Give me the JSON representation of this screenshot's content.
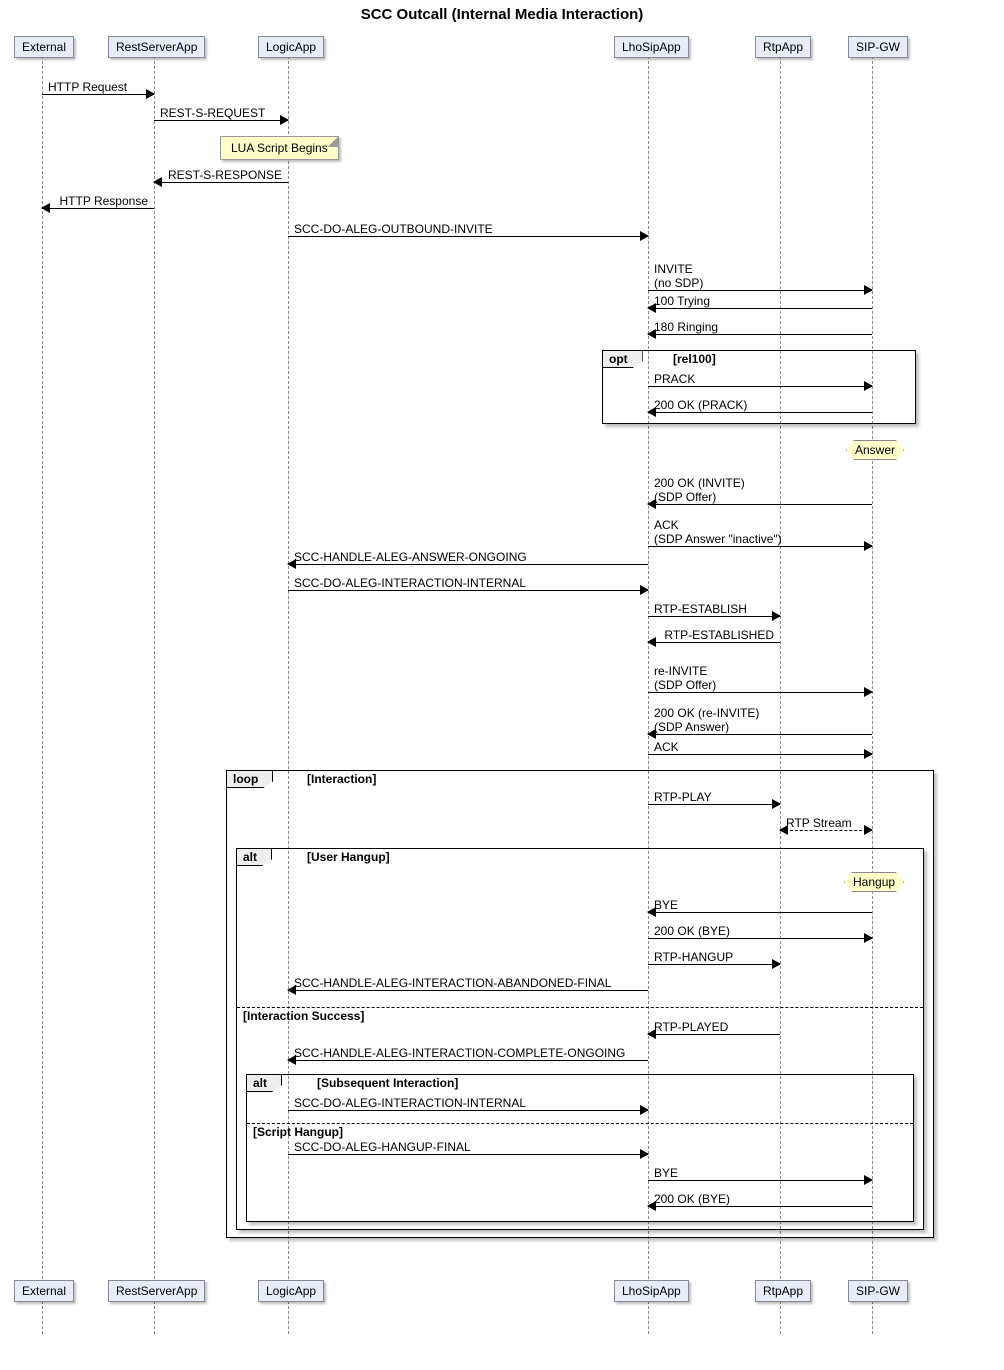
{
  "title": "SCC Outcall (Internal Media Interaction)",
  "actors": {
    "external": "External",
    "rest": "RestServerApp",
    "logic": "LogicApp",
    "lho": "LhoSipApp",
    "rtp": "RtpApp",
    "sip": "SIP-GW"
  },
  "notes": {
    "lua": "LUA Script Begins",
    "answer": "Answer",
    "hangup": "Hangup"
  },
  "fragments": {
    "opt": {
      "tag": "opt",
      "cond": "[rel100]"
    },
    "loop": {
      "tag": "loop",
      "cond": "[Interaction]"
    },
    "alt1": {
      "tag": "alt",
      "cond": "[User Hangup]",
      "else": "[Interaction Success]"
    },
    "alt2": {
      "tag": "alt",
      "cond": "[Subsequent Interaction]",
      "else": "[Script Hangup]"
    }
  },
  "messages": {
    "m1": "HTTP Request",
    "m2": "REST-S-REQUEST",
    "m3": "REST-S-RESPONSE",
    "m4": "HTTP Response",
    "m5": "SCC-DO-ALEG-OUTBOUND-INVITE",
    "m6a": "INVITE",
    "m6b": "(no SDP)",
    "m7": "100 Trying",
    "m8": "180 Ringing",
    "m9": "PRACK",
    "m10": "200 OK (PRACK)",
    "m11a": "200 OK (INVITE)",
    "m11b": "(SDP Offer)",
    "m12a": "ACK",
    "m12b": "(SDP Answer \"inactive\")",
    "m13": "SCC-HANDLE-ALEG-ANSWER-ONGOING",
    "m14": "SCC-DO-ALEG-INTERACTION-INTERNAL",
    "m15": "RTP-ESTABLISH",
    "m16": "RTP-ESTABLISHED",
    "m17a": "re-INVITE",
    "m17b": "(SDP Offer)",
    "m18a": "200 OK (re-INVITE)",
    "m18b": "(SDP Answer)",
    "m19": "ACK",
    "m20": "RTP-PLAY",
    "m21": "RTP Stream",
    "m22": "BYE",
    "m23": "200 OK (BYE)",
    "m24": "RTP-HANGUP",
    "m25": "SCC-HANDLE-ALEG-INTERACTION-ABANDONED-FINAL",
    "m26": "RTP-PLAYED",
    "m27": "SCC-HANDLE-ALEG-INTERACTION-COMPLETE-ONGOING",
    "m28": "SCC-DO-ALEG-INTERACTION-INTERNAL",
    "m29": "SCC-DO-ALEG-HANGUP-FINAL",
    "m30": "BYE",
    "m31": "200 OK (BYE)"
  },
  "chart_data": {
    "type": "sequence-diagram",
    "title": "SCC Outcall (Internal Media Interaction)",
    "participants": [
      "External",
      "RestServerApp",
      "LogicApp",
      "LhoSipApp",
      "RtpApp",
      "SIP-GW"
    ],
    "sequence": [
      {
        "from": "External",
        "to": "RestServerApp",
        "label": "HTTP Request"
      },
      {
        "from": "RestServerApp",
        "to": "LogicApp",
        "label": "REST-S-REQUEST"
      },
      {
        "note_over": "LogicApp",
        "text": "LUA Script Begins"
      },
      {
        "from": "LogicApp",
        "to": "RestServerApp",
        "label": "REST-S-RESPONSE"
      },
      {
        "from": "RestServerApp",
        "to": "External",
        "label": "HTTP Response"
      },
      {
        "from": "LogicApp",
        "to": "LhoSipApp",
        "label": "SCC-DO-ALEG-OUTBOUND-INVITE"
      },
      {
        "from": "LhoSipApp",
        "to": "SIP-GW",
        "label": "INVITE (no SDP)"
      },
      {
        "from": "SIP-GW",
        "to": "LhoSipApp",
        "label": "100 Trying"
      },
      {
        "from": "SIP-GW",
        "to": "LhoSipApp",
        "label": "180 Ringing"
      },
      {
        "fragment": "opt",
        "cond": "rel100",
        "body": [
          {
            "from": "LhoSipApp",
            "to": "SIP-GW",
            "label": "PRACK"
          },
          {
            "from": "SIP-GW",
            "to": "LhoSipApp",
            "label": "200 OK (PRACK)"
          }
        ]
      },
      {
        "note_over": "SIP-GW",
        "text": "Answer"
      },
      {
        "from": "SIP-GW",
        "to": "LhoSipApp",
        "label": "200 OK (INVITE) (SDP Offer)"
      },
      {
        "from": "LhoSipApp",
        "to": "SIP-GW",
        "label": "ACK (SDP Answer \"inactive\")"
      },
      {
        "from": "LhoSipApp",
        "to": "LogicApp",
        "label": "SCC-HANDLE-ALEG-ANSWER-ONGOING"
      },
      {
        "from": "LogicApp",
        "to": "LhoSipApp",
        "label": "SCC-DO-ALEG-INTERACTION-INTERNAL"
      },
      {
        "from": "LhoSipApp",
        "to": "RtpApp",
        "label": "RTP-ESTABLISH"
      },
      {
        "from": "RtpApp",
        "to": "LhoSipApp",
        "label": "RTP-ESTABLISHED"
      },
      {
        "from": "LhoSipApp",
        "to": "SIP-GW",
        "label": "re-INVITE (SDP Offer)"
      },
      {
        "from": "SIP-GW",
        "to": "LhoSipApp",
        "label": "200 OK (re-INVITE) (SDP Answer)"
      },
      {
        "from": "LhoSipApp",
        "to": "SIP-GW",
        "label": "ACK"
      },
      {
        "fragment": "loop",
        "cond": "Interaction",
        "body": [
          {
            "from": "LhoSipApp",
            "to": "RtpApp",
            "label": "RTP-PLAY"
          },
          {
            "from": "RtpApp",
            "to": "SIP-GW",
            "label": "RTP Stream",
            "dashed": true,
            "bidir": true
          },
          {
            "fragment": "alt",
            "branches": [
              {
                "cond": "User Hangup",
                "body": [
                  {
                    "note_over": "SIP-GW",
                    "text": "Hangup"
                  },
                  {
                    "from": "SIP-GW",
                    "to": "LhoSipApp",
                    "label": "BYE"
                  },
                  {
                    "from": "LhoSipApp",
                    "to": "SIP-GW",
                    "label": "200 OK (BYE)"
                  },
                  {
                    "from": "LhoSipApp",
                    "to": "RtpApp",
                    "label": "RTP-HANGUP"
                  },
                  {
                    "from": "LhoSipApp",
                    "to": "LogicApp",
                    "label": "SCC-HANDLE-ALEG-INTERACTION-ABANDONED-FINAL"
                  }
                ]
              },
              {
                "cond": "Interaction Success",
                "body": [
                  {
                    "from": "RtpApp",
                    "to": "LhoSipApp",
                    "label": "RTP-PLAYED"
                  },
                  {
                    "from": "LhoSipApp",
                    "to": "LogicApp",
                    "label": "SCC-HANDLE-ALEG-INTERACTION-COMPLETE-ONGOING"
                  },
                  {
                    "fragment": "alt",
                    "branches": [
                      {
                        "cond": "Subsequent Interaction",
                        "body": [
                          {
                            "from": "LogicApp",
                            "to": "LhoSipApp",
                            "label": "SCC-DO-ALEG-INTERACTION-INTERNAL"
                          }
                        ]
                      },
                      {
                        "cond": "Script Hangup",
                        "body": [
                          {
                            "from": "LogicApp",
                            "to": "LhoSipApp",
                            "label": "SCC-DO-ALEG-HANGUP-FINAL"
                          },
                          {
                            "from": "LhoSipApp",
                            "to": "SIP-GW",
                            "label": "BYE"
                          },
                          {
                            "from": "SIP-GW",
                            "to": "LhoSipApp",
                            "label": "200 OK (BYE)"
                          }
                        ]
                      }
                    ]
                  }
                ]
              }
            ]
          }
        ]
      }
    ]
  }
}
